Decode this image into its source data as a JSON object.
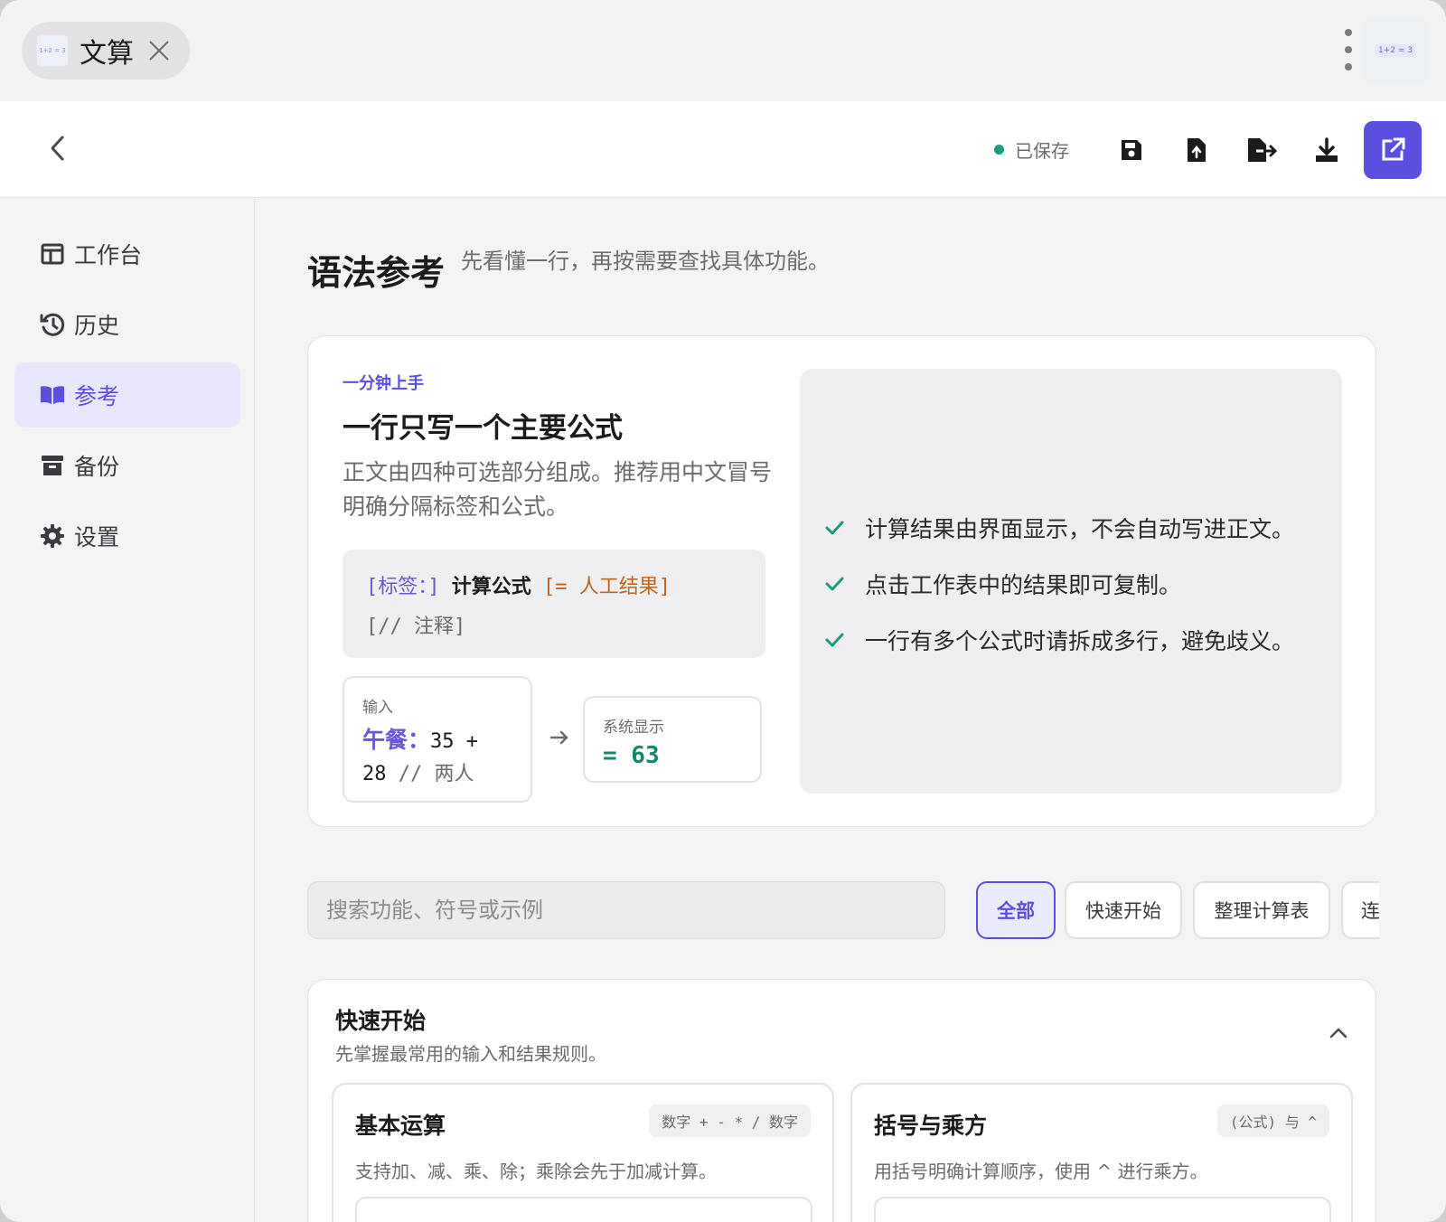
{
  "tab": {
    "title": "文算",
    "favicon_text": "1+2 = 3"
  },
  "app_thumb": {
    "text": "1+2 = 3"
  },
  "header": {
    "status": "已保存",
    "toolbar": [
      "save-icon",
      "file-upload-icon",
      "file-export-icon",
      "download-icon",
      "external-link-icon"
    ]
  },
  "sidebar": {
    "items": [
      {
        "label": "工作台",
        "icon": "columns-icon",
        "active": false
      },
      {
        "label": "历史",
        "icon": "history-icon",
        "active": false
      },
      {
        "label": "参考",
        "icon": "book-open-icon",
        "active": true
      },
      {
        "label": "备份",
        "icon": "archive-icon",
        "active": false
      },
      {
        "label": "设置",
        "icon": "gear-icon",
        "active": false
      }
    ]
  },
  "page": {
    "title": "语法参考",
    "subtitle": "先看懂一行，再按需要查找具体功能。"
  },
  "intro": {
    "eyebrow": "一分钟上手",
    "heading": "一行只写一个主要公式",
    "description": "正文由四种可选部分组成。推荐用中文冒号明确分隔标签和公式。",
    "syntax": {
      "label_part": "[标签：]",
      "formula_part": "计算公式",
      "result_part": "[= 人工结果]",
      "comment_part": "[// 注释]"
    },
    "example": {
      "input_caption": "输入",
      "input_label": "午餐：",
      "input_expr_1": "35 +",
      "input_expr_2": "28 ",
      "input_comment": "// 两人",
      "output_caption": "系统显示",
      "output_value": "= 63"
    },
    "tips": [
      "计算结果由界面显示，不会自动写进正文。",
      "点击工作表中的结果即可复制。",
      "一行有多个公式时请拆成多行，避免歧义。"
    ]
  },
  "search": {
    "placeholder": "搜索功能、符号或示例",
    "value": ""
  },
  "filters": [
    "全部",
    "快速开始",
    "整理计算表",
    "连"
  ],
  "section": {
    "title": "快速开始",
    "subtitle": "先掌握最常用的输入和结果规则。",
    "cards": [
      {
        "title": "基本运算",
        "badge": "数字 + - * / 数字",
        "desc": "支持加、减、乘、除；乘除会先于加减计算。"
      },
      {
        "title": "括号与乘方",
        "badge": "(公式) 与 ^",
        "desc": "用括号明确计算顺序，使用 ^ 进行乘方。"
      }
    ]
  },
  "colors": {
    "accent": "#5b4fe0",
    "success": "#1a9a7f",
    "result_orange": "#c0651e"
  }
}
